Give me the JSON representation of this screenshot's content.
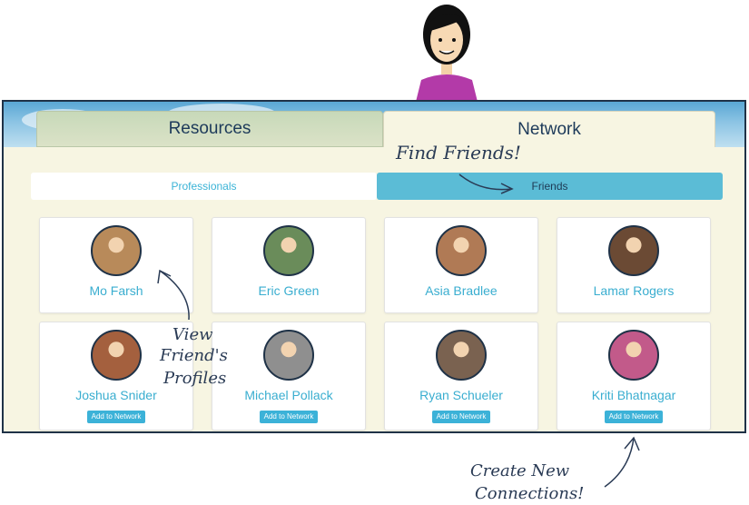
{
  "tabs": {
    "resources": "Resources",
    "network": "Network"
  },
  "subtabs": {
    "professionals": "Professionals",
    "friends": "Friends"
  },
  "friends": [
    {
      "name": "Mo Farsh",
      "photo_color": "#b88a5a"
    },
    {
      "name": "Eric Green",
      "photo_color": "#6a8c5a"
    },
    {
      "name": "Asia Bradlee",
      "photo_color": "#b07a55"
    },
    {
      "name": "Lamar Rogers",
      "photo_color": "#6b4a34"
    },
    {
      "name": "Joshua Snider",
      "photo_color": "#a4603e"
    },
    {
      "name": "Michael Pollack",
      "photo_color": "#8f8f8f"
    },
    {
      "name": "Ryan Schueler",
      "photo_color": "#7a6250"
    },
    {
      "name": "Kriti Bhatnagar",
      "photo_color": "#c25a8a"
    }
  ],
  "add_label": "Add to Network",
  "annotations": {
    "find_friends": "Find Friends!",
    "view_profiles_1": "View",
    "view_profiles_2": "Friend's",
    "view_profiles_3": "Profiles",
    "create_1": "Create New",
    "create_2": "Connections!"
  },
  "colors": {
    "accent": "#3aaed0",
    "friends_tab": "#5bbcd6",
    "background": "#f7f5e2"
  }
}
